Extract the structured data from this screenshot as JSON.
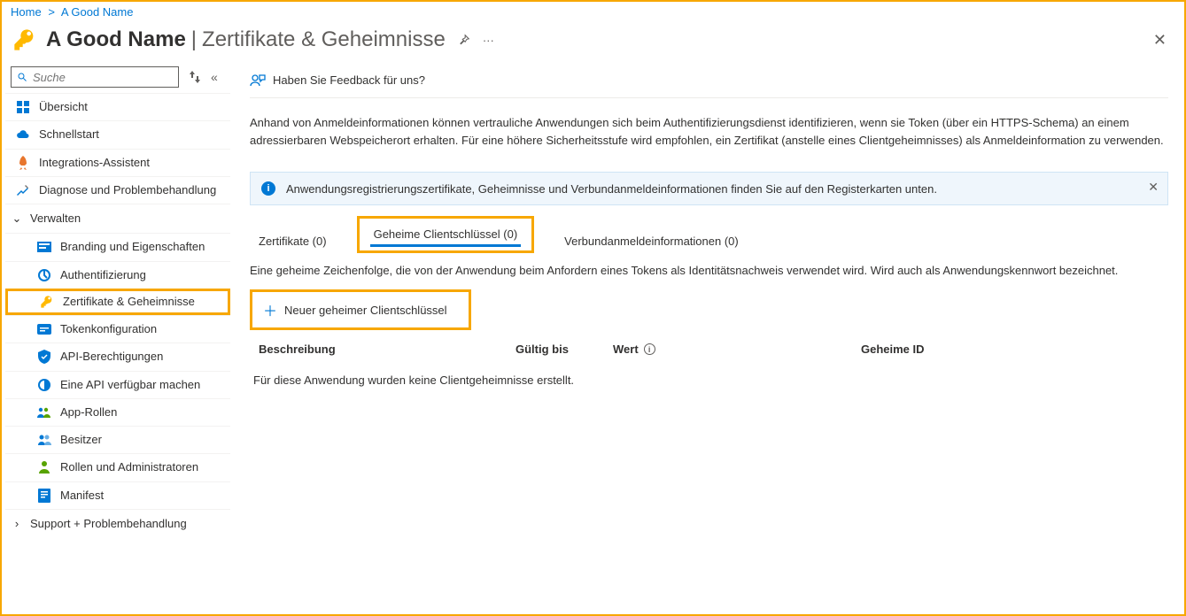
{
  "breadcrumb": {
    "home": "Home",
    "app": "A Good Name"
  },
  "header": {
    "app_name": "A Good Name",
    "page_name": "Zertifikate & Geheimnisse"
  },
  "sidebar": {
    "search_placeholder": "Suche",
    "items": {
      "overview": "Übersicht",
      "quickstart": "Schnellstart",
      "integration": "Integrations-Assistent",
      "diagnose": "Diagnose und Problembehandlung"
    },
    "verwalten_label": "Verwalten",
    "verwalten": {
      "branding": "Branding und Eigenschaften",
      "auth": "Authentifizierung",
      "certs": "Zertifikate & Geheimnisse",
      "token": "Tokenkonfiguration",
      "apiperms": "API-Berechtigungen",
      "exposeapi": "Eine API verfügbar machen",
      "approles": "App-Rollen",
      "owners": "Besitzer",
      "roles": "Rollen und Administratoren",
      "manifest": "Manifest"
    },
    "support_label": "Support + Problembehandlung"
  },
  "toolbar": {
    "feedback": "Haben Sie Feedback für uns?"
  },
  "main": {
    "description": "Anhand von Anmeldeinformationen können vertrauliche Anwendungen sich beim Authentifizierungsdienst identifizieren, wenn sie Token (über ein HTTPS-Schema) an einem adressierbaren Webspeicherort erhalten. Für eine höhere Sicherheitsstufe wird empfohlen, ein Zertifikat (anstelle eines Clientgeheimnisses) als Anmeldeinformation zu verwenden.",
    "info_text": "Anwendungsregistrierungszertifikate, Geheimnisse und Verbundanmeldeinformationen finden Sie auf den Registerkarten unten.",
    "tabs": {
      "certs": "Zertifikate (0)",
      "secrets": "Geheime Clientschlüssel (0)",
      "federated": "Verbundanmeldeinformationen (0)"
    },
    "tab_description": "Eine geheime Zeichenfolge, die von der Anwendung beim Anfordern eines Tokens als Identitätsnachweis verwendet wird. Wird auch als Anwendungskennwort bezeichnet.",
    "new_secret": "Neuer geheimer Clientschlüssel",
    "columns": {
      "description": "Beschreibung",
      "expires": "Gültig bis",
      "value": "Wert",
      "secret_id": "Geheime ID"
    },
    "empty_message": "Für diese Anwendung wurden keine Clientgeheimnisse erstellt."
  }
}
